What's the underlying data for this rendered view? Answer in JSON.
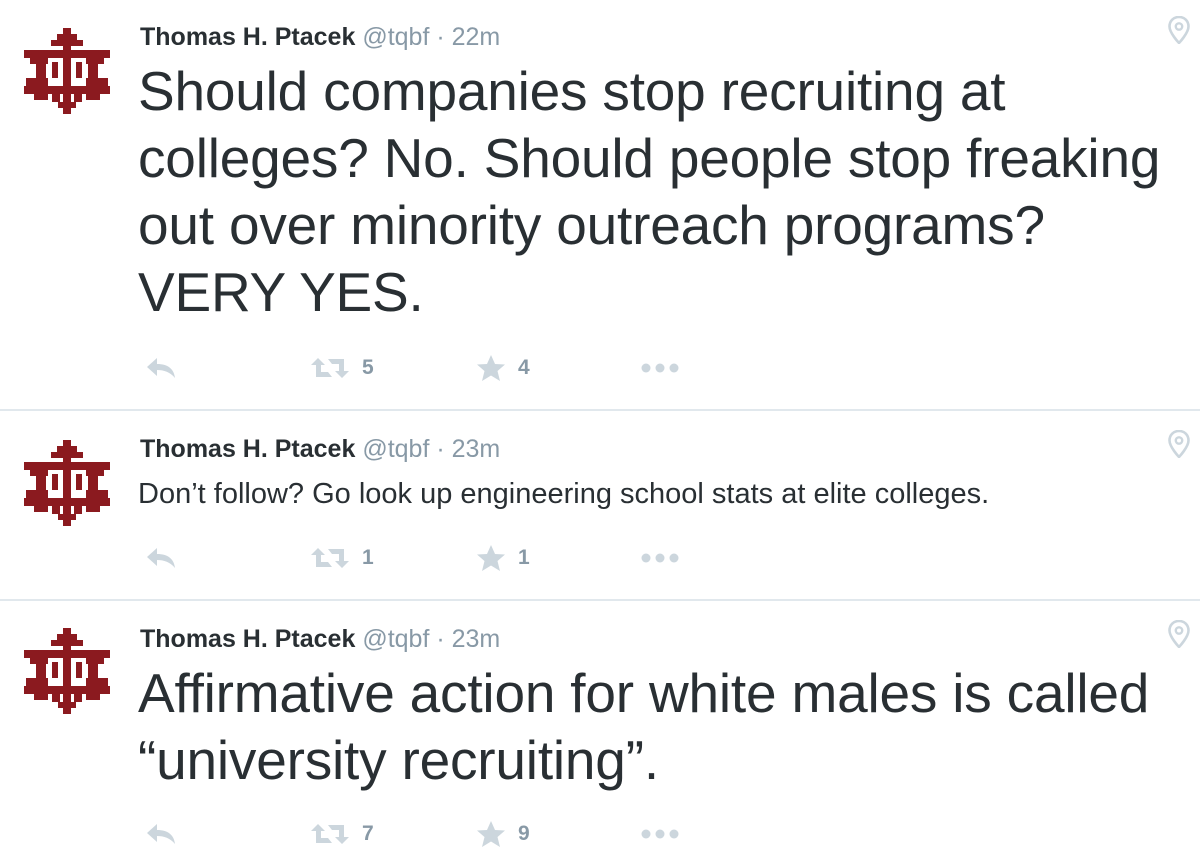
{
  "colors": {
    "text": "#292f33",
    "muted": "#8899a6",
    "icon": "#ccd6dd",
    "divider": "#e1e8ed",
    "avatar": "#8b1a1f"
  },
  "tweets": [
    {
      "author": "Thomas H. Ptacek",
      "handle": "@tqbf",
      "separator": "·",
      "time": "22m",
      "text": "Should companies stop recruiting at colleges? No. Should people stop freaking out over minority outreach programs? VERY YES.",
      "retweets": "5",
      "favorites": "4",
      "icons": [
        "avatar-logo",
        "location-pin-icon",
        "reply-icon",
        "retweet-icon",
        "star-icon",
        "more-icon"
      ]
    },
    {
      "author": "Thomas H. Ptacek",
      "handle": "@tqbf",
      "separator": "·",
      "time": "23m",
      "text": "Don’t follow? Go look up engineering school stats at elite colleges.",
      "retweets": "1",
      "favorites": "1",
      "icons": [
        "avatar-logo",
        "location-pin-icon",
        "reply-icon",
        "retweet-icon",
        "star-icon",
        "more-icon"
      ]
    },
    {
      "author": "Thomas H. Ptacek",
      "handle": "@tqbf",
      "separator": "·",
      "time": "23m",
      "text": "Affirmative action for white males is called “university recruiting”.",
      "retweets": "7",
      "favorites": "9",
      "icons": [
        "avatar-logo",
        "location-pin-icon",
        "reply-icon",
        "retweet-icon",
        "star-icon",
        "more-icon"
      ]
    }
  ]
}
